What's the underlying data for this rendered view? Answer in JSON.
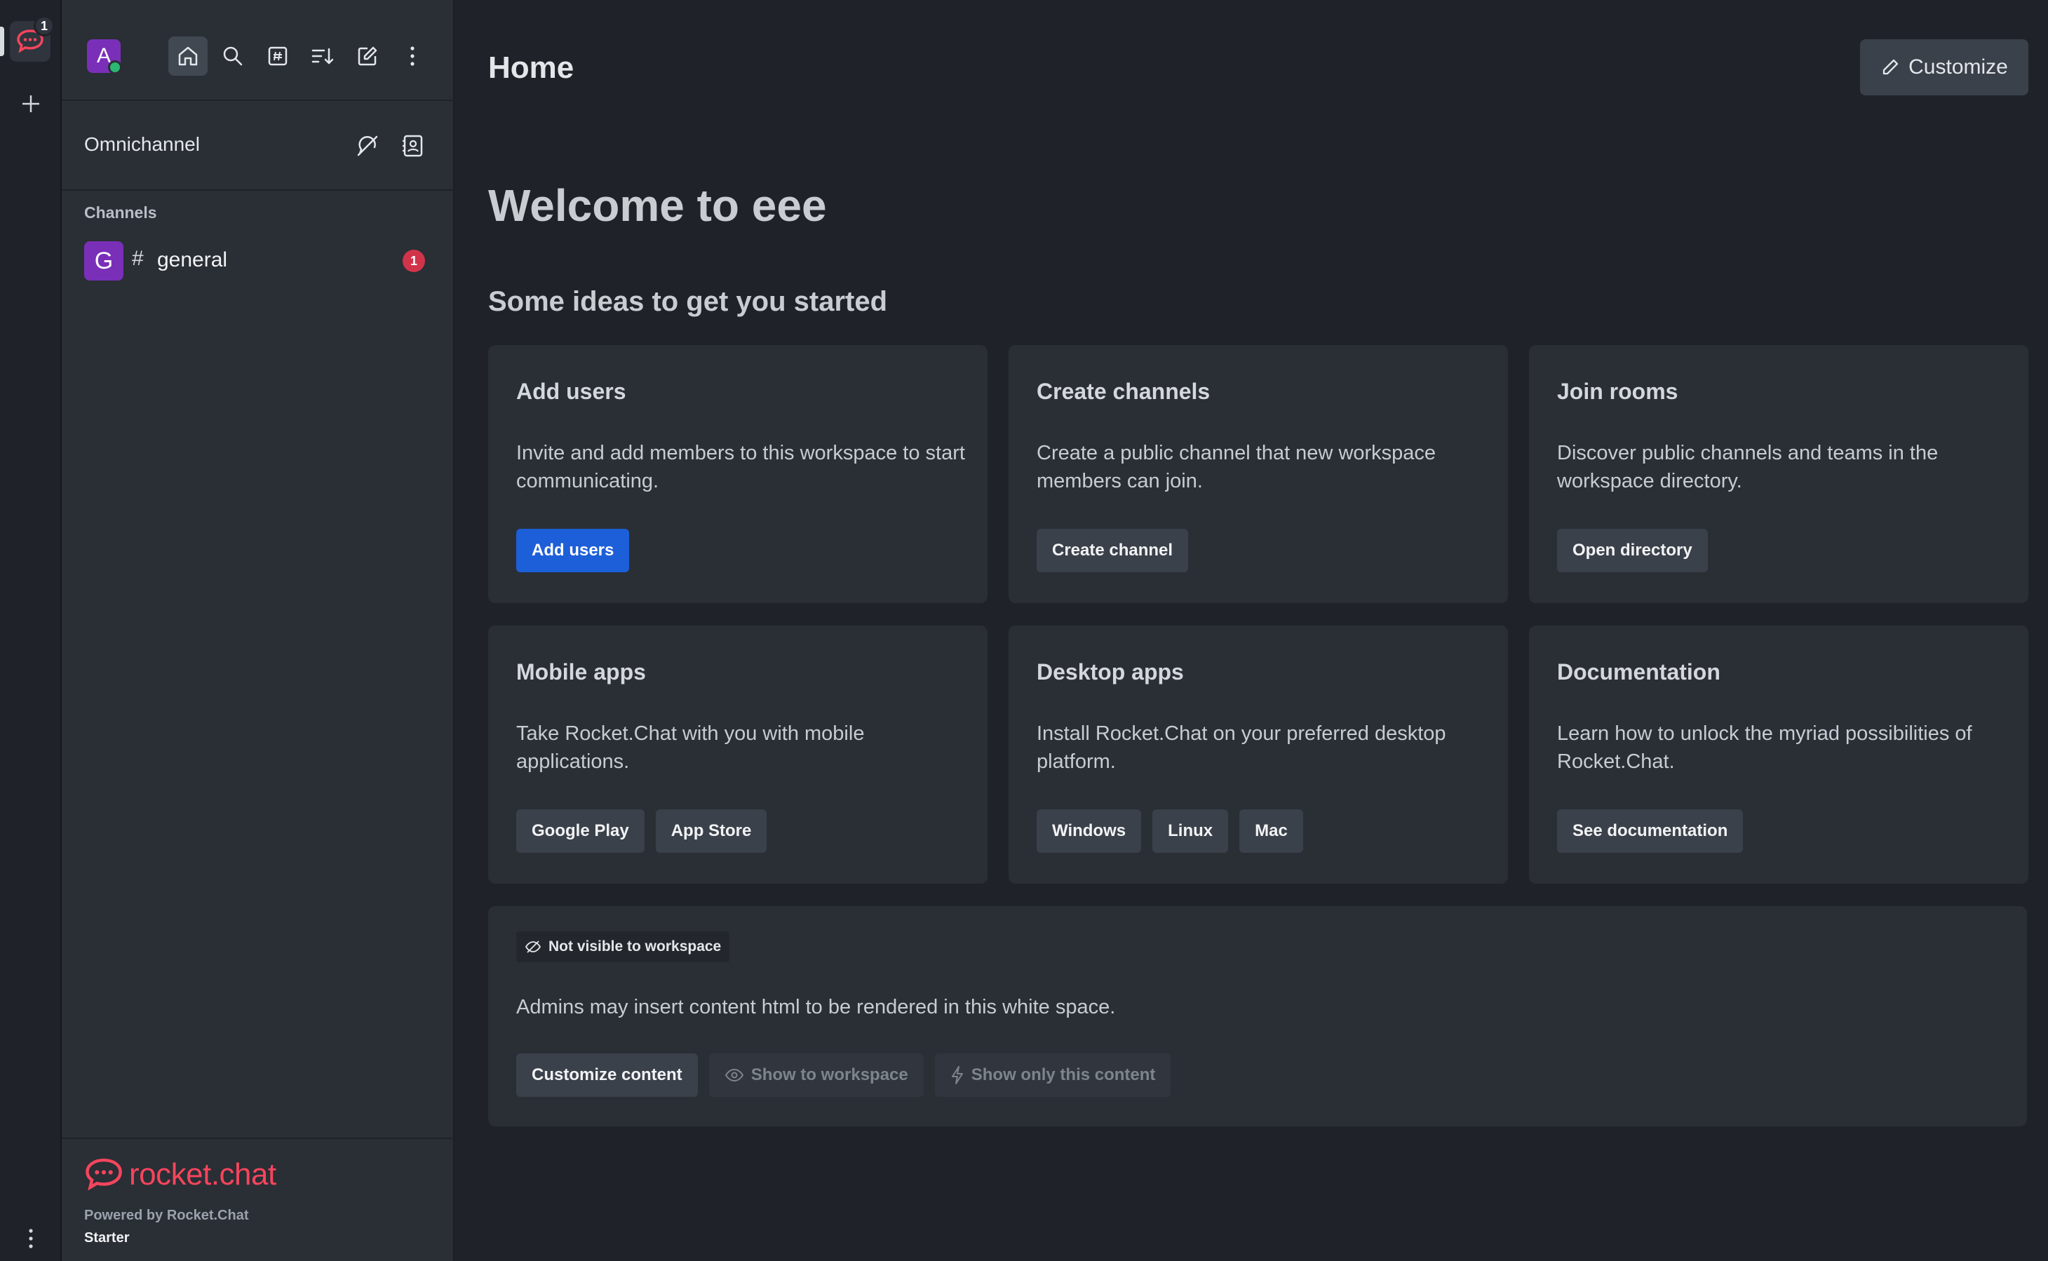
{
  "rail": {
    "server_badge": "1"
  },
  "sidebar": {
    "avatar_letter": "A",
    "omnichannel_label": "Omnichannel",
    "section_title": "Channels",
    "channel": {
      "avatar_letter": "G",
      "hash": "#",
      "name": "general",
      "unread": "1"
    },
    "footer": {
      "brand": "rocket.chat",
      "powered_by": "Powered by Rocket.Chat",
      "plan": "Starter"
    }
  },
  "main": {
    "title": "Home",
    "customize_label": "Customize",
    "welcome": "Welcome to eee",
    "ideas_title": "Some ideas to get you started",
    "cards": [
      {
        "title": "Add users",
        "desc": "Invite and add members to this workspace to start communicating.",
        "actions": [
          "Add users"
        ]
      },
      {
        "title": "Create channels",
        "desc": "Create a public channel that new workspace members can join.",
        "actions": [
          "Create channel"
        ]
      },
      {
        "title": "Join rooms",
        "desc": "Discover public channels and teams in the workspace directory.",
        "actions": [
          "Open directory"
        ]
      },
      {
        "title": "Mobile apps",
        "desc": "Take Rocket.Chat with you with mobile applications.",
        "actions": [
          "Google Play",
          "App Store"
        ]
      },
      {
        "title": "Desktop apps",
        "desc": "Install Rocket.Chat on your preferred desktop platform.",
        "actions": [
          "Windows",
          "Linux",
          "Mac"
        ]
      },
      {
        "title": "Documentation",
        "desc": "Learn how to unlock the myriad possibilities of Rocket.Chat.",
        "actions": [
          "See documentation"
        ]
      }
    ],
    "custom_content": {
      "visibility_tag": "Not visible to workspace",
      "desc": "Admins may insert content html to be rendered in this white space.",
      "actions": [
        "Customize content",
        "Show to workspace",
        "Show only this content"
      ]
    }
  },
  "colors": {
    "primary": "#1d5fd8",
    "brand": "#f5455c",
    "badge": "#d1344a",
    "avatar": "#7a2fb8",
    "online": "#2bb673"
  }
}
